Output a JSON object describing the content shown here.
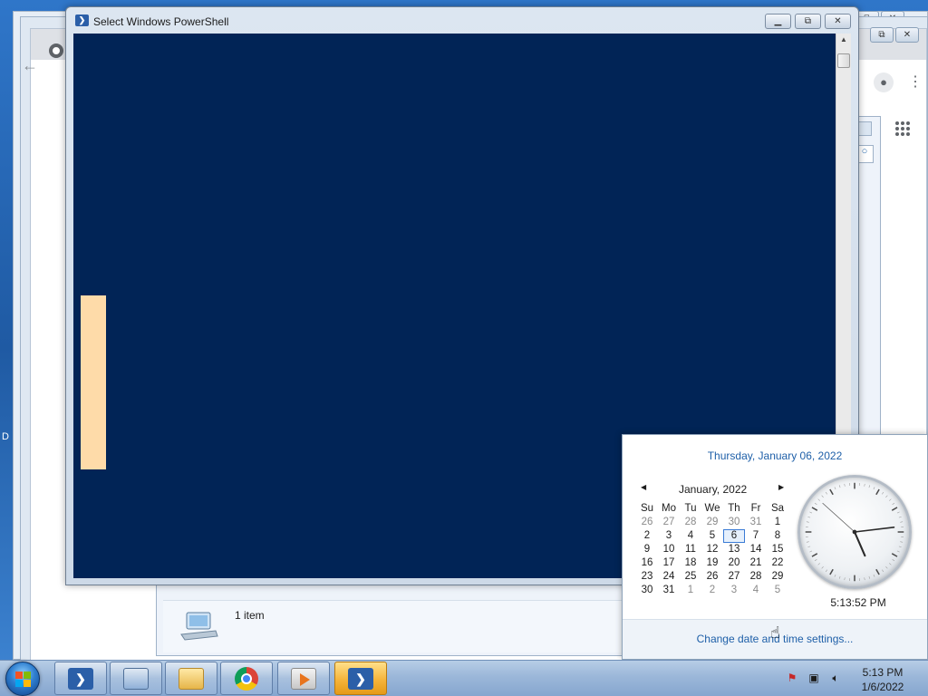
{
  "powershell_window": {
    "title": "Select Windows PowerShell",
    "minimize_label": "▭",
    "restore_label": "⧉",
    "close_label": "✕",
    "icon": "powershell-icon"
  },
  "explorer_window": {
    "status_text": "1 item",
    "icon": "computer-icon"
  },
  "chrome_window": {
    "back_icon": "back-arrow-icon",
    "profile_icon": "profile-icon",
    "menu_icon": "kebab-menu-icon",
    "apps_icon": "apps-grid-icon"
  },
  "desktop": {
    "edge_label": "D"
  },
  "clock_flyout": {
    "long_date": "Thursday, January 06, 2022",
    "month_label": "January, 2022",
    "prev_month_icon": "chevron-left-icon",
    "next_month_icon": "chevron-right-icon",
    "weekday_headers": [
      "Su",
      "Mo",
      "Tu",
      "We",
      "Th",
      "Fr",
      "Sa"
    ],
    "weeks": [
      [
        {
          "d": "26",
          "other": true
        },
        {
          "d": "27",
          "other": true
        },
        {
          "d": "28",
          "other": true
        },
        {
          "d": "29",
          "other": true
        },
        {
          "d": "30",
          "other": true
        },
        {
          "d": "31",
          "other": true
        },
        {
          "d": "1"
        }
      ],
      [
        {
          "d": "2"
        },
        {
          "d": "3"
        },
        {
          "d": "4"
        },
        {
          "d": "5"
        },
        {
          "d": "6",
          "today": true
        },
        {
          "d": "7"
        },
        {
          "d": "8"
        }
      ],
      [
        {
          "d": "9"
        },
        {
          "d": "10"
        },
        {
          "d": "11"
        },
        {
          "d": "12"
        },
        {
          "d": "13"
        },
        {
          "d": "14"
        },
        {
          "d": "15"
        }
      ],
      [
        {
          "d": "16"
        },
        {
          "d": "17"
        },
        {
          "d": "18"
        },
        {
          "d": "19"
        },
        {
          "d": "20"
        },
        {
          "d": "21"
        },
        {
          "d": "22"
        }
      ],
      [
        {
          "d": "23"
        },
        {
          "d": "24"
        },
        {
          "d": "25"
        },
        {
          "d": "26"
        },
        {
          "d": "27"
        },
        {
          "d": "28"
        },
        {
          "d": "29"
        }
      ],
      [
        {
          "d": "30"
        },
        {
          "d": "31"
        },
        {
          "d": "1",
          "other": true
        },
        {
          "d": "2",
          "other": true
        },
        {
          "d": "3",
          "other": true
        },
        {
          "d": "4",
          "other": true
        },
        {
          "d": "5",
          "other": true
        }
      ]
    ],
    "clock_time": "5:13:52 PM",
    "clock_hands": {
      "hour": 5,
      "minute": 13,
      "second": 52
    },
    "change_settings_link": "Change date and time settings..."
  },
  "taskbar": {
    "start_icon": "windows-start-orb-icon",
    "buttons": [
      {
        "name": "powershell-taskbar-button",
        "icon": "powershell-icon",
        "glyph": "❯"
      },
      {
        "name": "server-manager-taskbar-button",
        "icon": "server-manager-icon"
      },
      {
        "name": "file-explorer-taskbar-button",
        "icon": "folder-icon"
      },
      {
        "name": "chrome-taskbar-button",
        "icon": "chrome-icon"
      },
      {
        "name": "media-player-taskbar-button",
        "icon": "media-player-icon"
      },
      {
        "name": "powershell-active-taskbar-button",
        "icon": "powershell-icon",
        "glyph": "❯",
        "active": true
      }
    ],
    "tray": {
      "action_center_icon": "flag-error-icon",
      "network_icon": "network-icon",
      "volume_icon": "speaker-icon",
      "time": "5:13 PM",
      "date": "1/6/2022"
    }
  },
  "colors": {
    "console_bg": "#012456",
    "console_cursor": "#fedba9",
    "link_blue": "#1e5fa8",
    "active_taskbar": "#f5b43a"
  }
}
